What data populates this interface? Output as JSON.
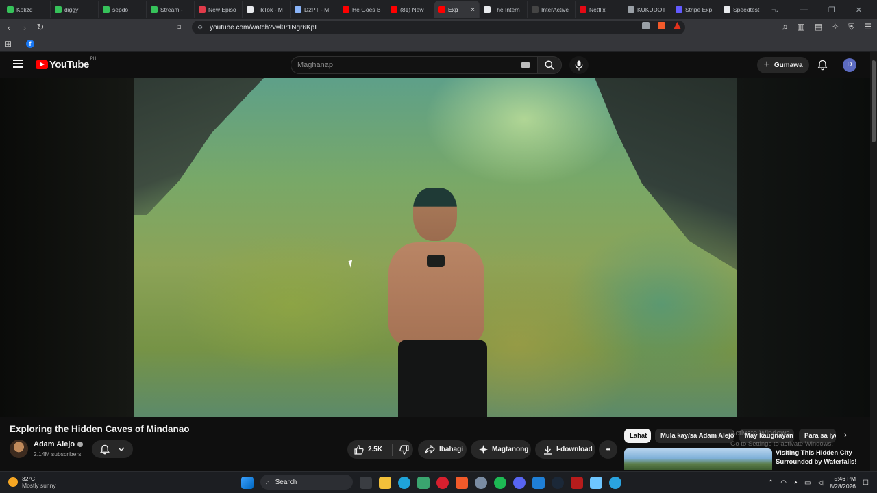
{
  "browser": {
    "tabs": [
      {
        "title": "Kokzd",
        "color": "#36c25a"
      },
      {
        "title": "diggy",
        "color": "#36c25a"
      },
      {
        "title": "sepdo",
        "color": "#36c25a"
      },
      {
        "title": "Stream - ",
        "color": "#36c25a"
      },
      {
        "title": "New Episo",
        "color": "#e23b4a"
      },
      {
        "title": "TikTok - M",
        "color": "#e8eaed"
      },
      {
        "title": "D2PT - M",
        "color": "#8ab4f8"
      },
      {
        "title": "He Goes B",
        "color": "#ff0000"
      },
      {
        "title": "(81) New",
        "color": "#ff0000"
      },
      {
        "title": "Exp",
        "color": "#ff0000",
        "active": true
      },
      {
        "title": "The Intern",
        "color": "#e8eaed"
      },
      {
        "title": "InterActive",
        "color": "#444444"
      },
      {
        "title": "Netflix",
        "color": "#e50914"
      },
      {
        "title": "KUKUDOT",
        "color": "#9aa0a6"
      },
      {
        "title": "Stripe Exp",
        "color": "#635bff"
      },
      {
        "title": "Speedtest",
        "color": "#e8eaed"
      }
    ],
    "new_tab": "+",
    "url": "youtube.com/watch?v=l0r1Ngr6KpI"
  },
  "youtube": {
    "logo_word": "YouTube",
    "country_code": "PH",
    "search_placeholder": "Maghanap",
    "create_label": "Gumawa",
    "avatar_letter": "D"
  },
  "video": {
    "title": "Exploring the Hidden Caves of Mindanao",
    "channel_name": "Adam Alejo",
    "subscribers": "2.14M subscribers",
    "likes": "2.5K",
    "share_label": "Ibahagi",
    "remix_label": "Magtanong",
    "download_label": "I-download",
    "more_label": "•••"
  },
  "chips": [
    "Lahat",
    "Mula kay/sa Adam Alejo",
    "May kaugnayan",
    "Para sa iyo"
  ],
  "activation": {
    "line1": "Activate Windows",
    "line2": "Go to Settings to activate Windows."
  },
  "recommendation": {
    "title": "Visiting This Hidden City Surrounded by Waterfalls!"
  },
  "taskbar": {
    "temperature": "32°C",
    "condition": "Mostly sunny",
    "search_label": "Search",
    "time": "5:46 PM",
    "date": "8/28/2026"
  }
}
